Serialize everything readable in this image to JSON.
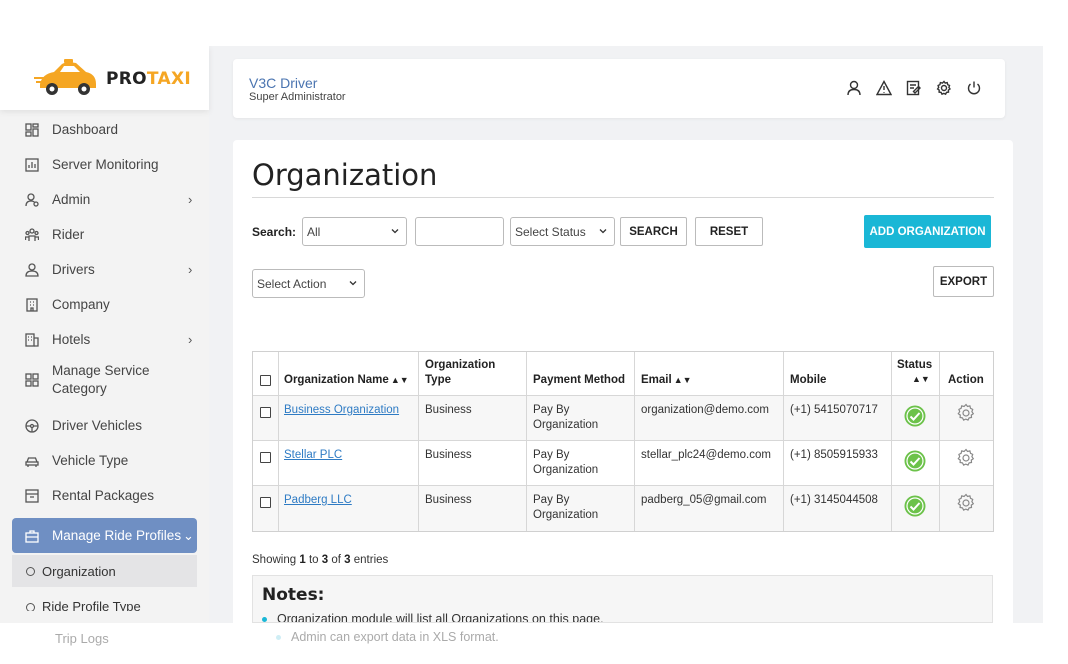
{
  "brand": {
    "pro": "PRO",
    "taxi": "TAXI"
  },
  "header": {
    "title": "V3C Driver",
    "subtitle": "Super Administrator"
  },
  "sidebar": {
    "items": [
      {
        "label": "Dashboard",
        "icon": "dashboard-icon"
      },
      {
        "label": "Server Monitoring",
        "icon": "chart-icon"
      },
      {
        "label": "Admin",
        "icon": "admin-icon",
        "chevron": "›"
      },
      {
        "label": "Rider",
        "icon": "rider-icon"
      },
      {
        "label": "Drivers",
        "icon": "driver-icon",
        "chevron": "›"
      },
      {
        "label": "Company",
        "icon": "building-icon"
      },
      {
        "label": "Hotels",
        "icon": "hotel-icon",
        "chevron": "›"
      },
      {
        "label": "Manage Service Category",
        "icon": "grid-icon"
      },
      {
        "label": "Driver Vehicles",
        "icon": "steering-icon"
      },
      {
        "label": "Vehicle Type",
        "icon": "car-icon"
      },
      {
        "label": "Rental Packages",
        "icon": "package-icon"
      },
      {
        "label": "Manage Ride Profiles",
        "icon": "briefcase-icon",
        "chevron": "⌄"
      }
    ],
    "sub_items": [
      {
        "label": "Organization"
      },
      {
        "label": "Ride Profile Type"
      }
    ],
    "faded_item": "Trip Logs"
  },
  "page": {
    "title": "Organization",
    "search_label": "Search:",
    "search_field_value": "All",
    "status_select_value": "Select Status",
    "search_button": "SEARCH",
    "reset_button": "RESET",
    "add_button": "ADD ORGANIZATION",
    "action_select_value": "Select Action",
    "export_button": "EXPORT"
  },
  "table": {
    "headers": {
      "name": "Organization Name",
      "type_1": "Organization",
      "type_2": "Type",
      "payment": "Payment Method",
      "email": "Email",
      "mobile": "Mobile",
      "status": "Status",
      "action": "Action"
    },
    "rows": [
      {
        "name": "Business Organization",
        "type": "Business",
        "pay_1": "Pay By",
        "pay_2": "Organization",
        "email": "organization@demo.com",
        "mobile": "(+1) 5415070717"
      },
      {
        "name": "Stellar PLC",
        "type": "Business",
        "pay_1": "Pay By",
        "pay_2": "Organization",
        "email": "stellar_plc24@demo.com",
        "mobile": "(+1) 8505915933"
      },
      {
        "name": "Padberg LLC",
        "type": "Business",
        "pay_1": "Pay By",
        "pay_2": "Organization",
        "email": "padberg_05@gmail.com",
        "mobile": "(+1) 3145044508"
      }
    ]
  },
  "showing": {
    "prefix": "Showing",
    "from": "1",
    "to_word": "to",
    "to": "3",
    "of_word": "of",
    "total": "3",
    "suffix": "entries"
  },
  "notes": {
    "title": "Notes:",
    "lines": [
      "Organization module will list all Organizations on this page.",
      "Admin can export data in XLS format."
    ]
  },
  "colors": {
    "accent": "#1ab7d6",
    "active_menu": "#6f8fc3",
    "brand_orange": "#f5a623",
    "status_ok": "#6cc24a"
  }
}
